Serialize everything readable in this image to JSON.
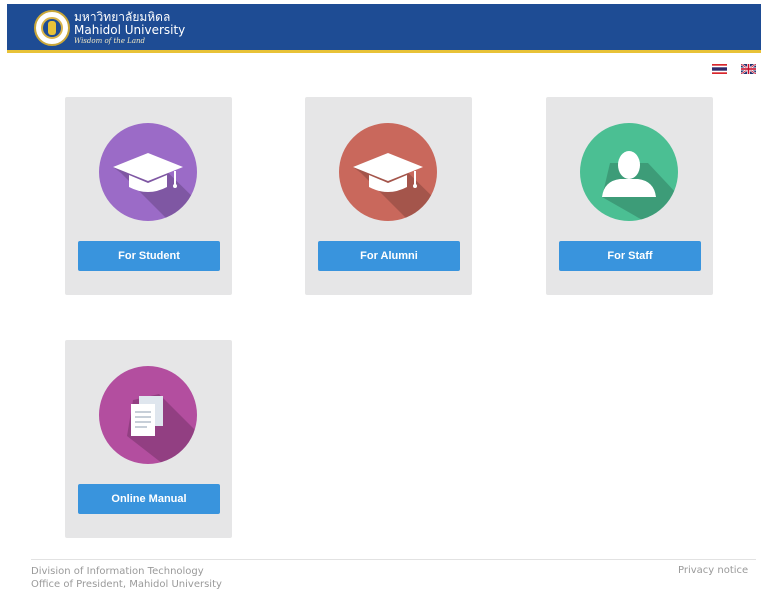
{
  "header": {
    "university_thai": "มหาวิทยาลัยมหิดล",
    "university_eng": "Mahidol University",
    "motto": "Wisdom of the Land"
  },
  "languages": [
    {
      "code": "th",
      "icon": "thai-flag-icon"
    },
    {
      "code": "en",
      "icon": "uk-flag-icon"
    }
  ],
  "cards": [
    {
      "label": "For Student",
      "icon": "graduation-cap-icon",
      "color": "#9b6bc7"
    },
    {
      "label": "For Alumni",
      "icon": "graduation-cap-icon",
      "color": "#c9685c"
    },
    {
      "label": "For Staff",
      "icon": "user-silhouette-icon",
      "color": "#4bbf93"
    },
    {
      "label": "Online Manual",
      "icon": "documents-icon",
      "color": "#b34e9f"
    }
  ],
  "footer": {
    "line1": "Division of Information Technology",
    "line2": "Office of President, Mahidol University",
    "privacy": "Privacy notice"
  },
  "colors": {
    "header_bg": "#1e4c94",
    "header_accent": "#e8c238",
    "button": "#3994dd",
    "card_bg": "#e6e6e7"
  }
}
